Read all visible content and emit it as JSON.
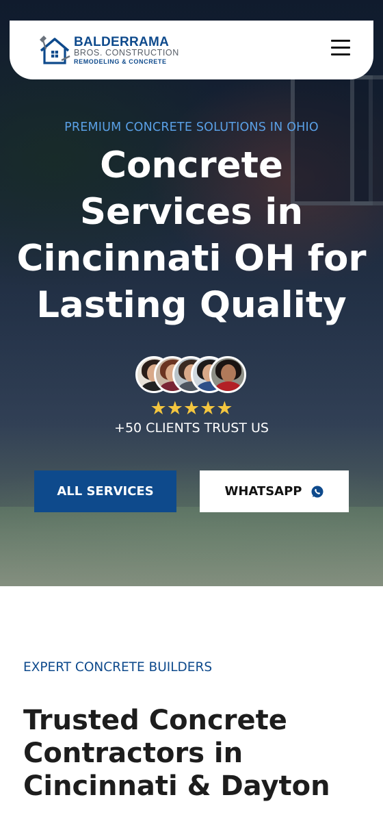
{
  "brand": {
    "name": "BALDERRAMA",
    "subtitle": "BROS. CONSTRUCTION",
    "tagline": "REMODELING & CONCRETE",
    "primary_color": "#0e4a8c"
  },
  "header": {
    "menu_icon": "hamburger-icon"
  },
  "hero": {
    "eyebrow": "PREMIUM CONCRETE SOLUTIONS IN OHIO",
    "title": "Concrete Services in Cincinnati OH for Lasting Quality",
    "rating_stars": "★★★★★",
    "rating": 5,
    "trust_text": "+50 CLIENTS TRUST US",
    "star_color": "#f4c63f",
    "eyebrow_color": "#5aa0e6"
  },
  "buttons": {
    "services_label": "ALL SERVICES",
    "whatsapp_label": "WHATSAPP",
    "whatsapp_icon": "whatsapp-icon"
  },
  "section": {
    "eyebrow": "EXPERT CONCRETE BUILDERS",
    "title": "Trusted Concrete Contractors in Cincinnati & Dayton"
  }
}
